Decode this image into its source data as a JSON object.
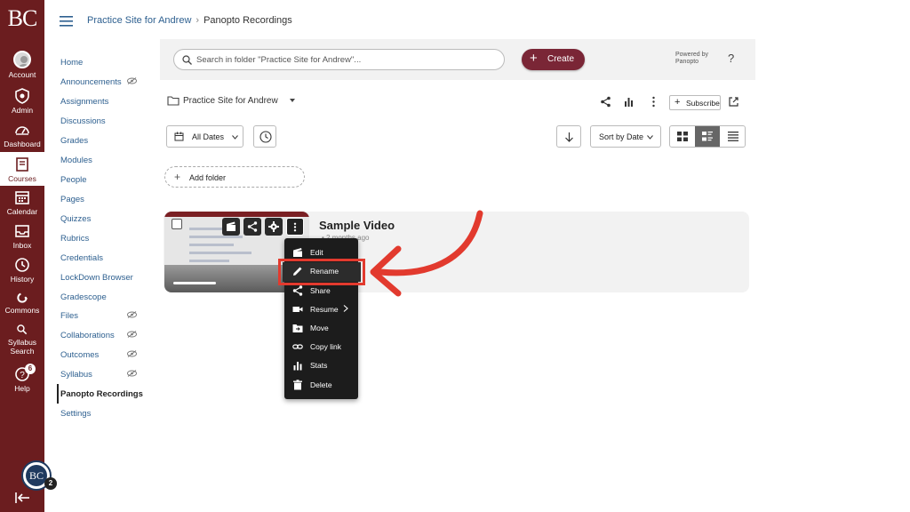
{
  "global_nav": {
    "logo": "BC",
    "items": [
      {
        "label": "Account"
      },
      {
        "label": "Admin"
      },
      {
        "label": "Dashboard"
      },
      {
        "label": "Courses"
      },
      {
        "label": "Calendar"
      },
      {
        "label": "Inbox"
      },
      {
        "label": "History"
      },
      {
        "label": "Commons"
      },
      {
        "label": "Syllabus Search"
      },
      {
        "label": "Help"
      }
    ],
    "help_badge": "6",
    "profile_initials": "BC",
    "profile_badge": "2"
  },
  "breadcrumb": {
    "course": "Practice Site for Andrew",
    "separator": "›",
    "current": "Panopto Recordings"
  },
  "course_nav": {
    "items": [
      {
        "label": "Home"
      },
      {
        "label": "Announcements"
      },
      {
        "label": "Assignments"
      },
      {
        "label": "Discussions"
      },
      {
        "label": "Grades"
      },
      {
        "label": "Modules"
      },
      {
        "label": "People"
      },
      {
        "label": "Pages"
      },
      {
        "label": "Quizzes"
      },
      {
        "label": "Rubrics"
      },
      {
        "label": "Credentials"
      },
      {
        "label": "LockDown Browser"
      },
      {
        "label": "Gradescope"
      },
      {
        "label": "Files"
      },
      {
        "label": "Collaborations"
      },
      {
        "label": "Outcomes"
      },
      {
        "label": "Syllabus"
      },
      {
        "label": "Panopto Recordings"
      },
      {
        "label": "Settings"
      }
    ],
    "active": "Panopto Recordings"
  },
  "panopto": {
    "search_placeholder": "Search in folder \"Practice Site for Andrew\"...",
    "create_label": "Create",
    "powered_by": "Powered by",
    "powered_brand": "Panopto",
    "help": "?",
    "folder_name": "Practice Site for Andrew",
    "subscribe_label": "Subscribe",
    "dates_filter": "All Dates",
    "sort_label": "Sort by Date",
    "add_folder_label": "Add folder",
    "session": {
      "title": "Sample Video",
      "subtitle": "• 2 months ago"
    },
    "menu": {
      "items": [
        {
          "label": "Edit",
          "icon": "edit-icon"
        },
        {
          "label": "Rename",
          "icon": "pencil-icon"
        },
        {
          "label": "Share",
          "icon": "share-icon"
        },
        {
          "label": "Resume",
          "icon": "video-camera-icon"
        },
        {
          "label": "Move",
          "icon": "move-icon"
        },
        {
          "label": "Copy link",
          "icon": "link-icon"
        },
        {
          "label": "Stats",
          "icon": "stats-icon"
        },
        {
          "label": "Delete",
          "icon": "trash-icon"
        }
      ]
    }
  },
  "colors": {
    "nav_bg": "#6b1d1f",
    "create_bg": "#7a2636",
    "highlight": "#e23a2e",
    "link": "#2d5f8f"
  }
}
